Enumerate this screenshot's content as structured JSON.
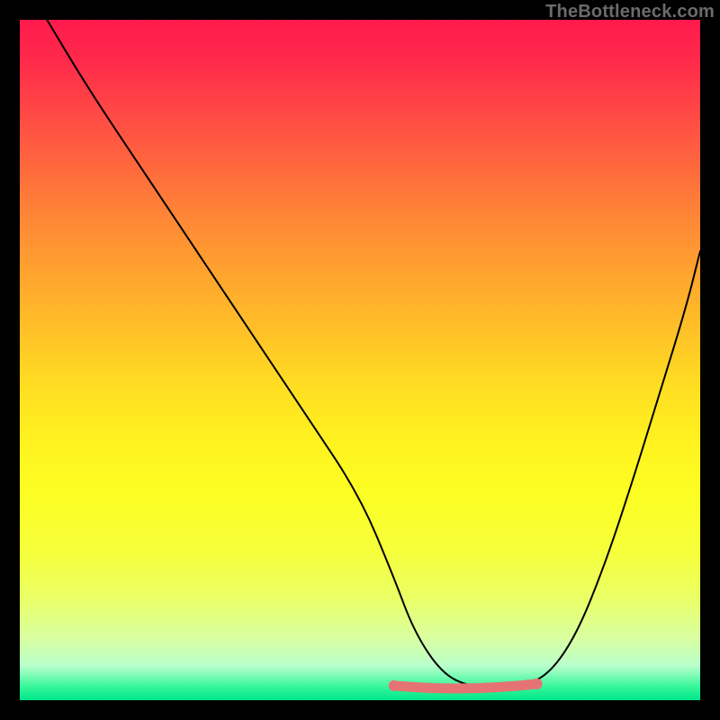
{
  "watermark": "TheBottleneck.com",
  "chart_data": {
    "type": "line",
    "title": "",
    "xlabel": "",
    "ylabel": "",
    "xlim": [
      0,
      100
    ],
    "ylim": [
      0,
      100
    ],
    "series": [
      {
        "name": "curve",
        "x": [
          4,
          10,
          18,
          26,
          34,
          42,
          50,
          55,
          58,
          62,
          66,
          70,
          74,
          78,
          82,
          86,
          90,
          94,
          98,
          100
        ],
        "values": [
          100,
          90,
          78,
          66,
          54,
          42,
          30,
          18,
          10,
          4,
          2,
          2,
          2,
          4,
          10,
          20,
          32,
          45,
          58,
          66
        ]
      }
    ],
    "highlight": {
      "color": "#e57373",
      "x_range": [
        55,
        76
      ],
      "y": 2
    },
    "background_gradient": {
      "top": "#ff1a4d",
      "mid": "#ffe020",
      "bottom": "#00e68a"
    }
  }
}
